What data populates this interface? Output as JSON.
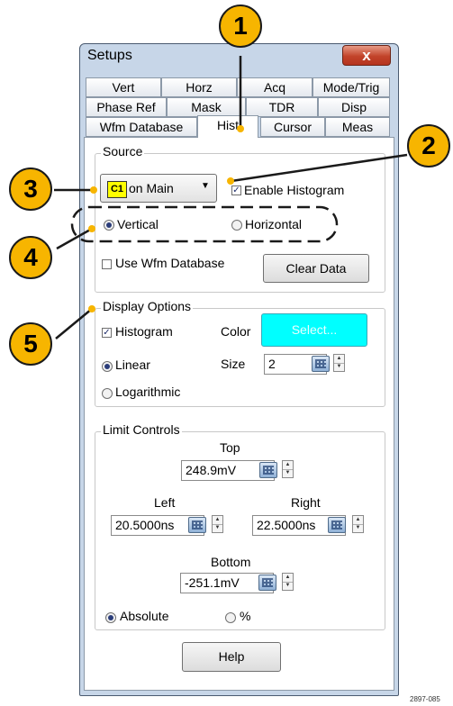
{
  "window": {
    "title": "Setups",
    "close_label": "x"
  },
  "tabs": {
    "row1": [
      "Vert",
      "Horz",
      "Acq",
      "Mode/Trig"
    ],
    "row2": [
      "Phase Ref",
      "Mask",
      "TDR",
      "Disp"
    ],
    "row3": [
      "Wfm Database",
      "Hist",
      "Cursor",
      "Meas"
    ],
    "active": "Hist"
  },
  "source": {
    "title": "Source",
    "channel_badge": "C1",
    "dropdown_value": "on Main",
    "enable_histogram_label": "Enable Histogram",
    "enable_histogram_checked": true,
    "vertical_label": "Vertical",
    "horizontal_label": "Horizontal",
    "orientation": "Vertical",
    "use_wfm_database_label": "Use Wfm Database",
    "use_wfm_database_checked": false,
    "clear_data_label": "Clear Data"
  },
  "display_options": {
    "title": "Display Options",
    "histogram_label": "Histogram",
    "histogram_checked": true,
    "color_label": "Color",
    "color_button_label": "Select...",
    "color_value": "#00ffff",
    "linear_label": "Linear",
    "logarithmic_label": "Logarithmic",
    "scale": "Linear",
    "size_label": "Size",
    "size_value": "2"
  },
  "limit_controls": {
    "title": "Limit Controls",
    "top_label": "Top",
    "top_value": "248.9mV",
    "left_label": "Left",
    "left_value": "20.5000ns",
    "right_label": "Right",
    "right_value": "22.5000ns",
    "bottom_label": "Bottom",
    "bottom_value": "-251.1mV",
    "absolute_label": "Absolute",
    "percent_label": "%",
    "mode": "Absolute"
  },
  "help_label": "Help",
  "callouts": [
    "1",
    "2",
    "3",
    "4",
    "5"
  ],
  "figure_id": "2897-085",
  "colors": {
    "callout": "#f7b500",
    "badge": "#ffff00",
    "frame": "#c7d6e8",
    "color_swatch": "#00ffff"
  }
}
